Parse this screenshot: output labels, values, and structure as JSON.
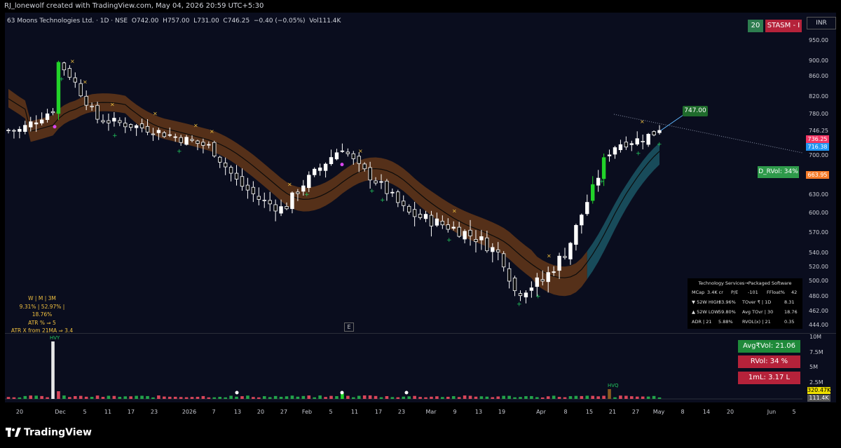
{
  "credit": "RJ_lonewolf created with TradingView.com, May 04, 2026 20:59 UTC+5:30",
  "legend": {
    "name": "63 Moons Technologies Ltd. · 1D · NSE",
    "o_label": "O",
    "o": "742.00",
    "h_label": "H",
    "h": "757.00",
    "l_label": "L",
    "l": "731.00",
    "c_label": "C",
    "c": "746.25",
    "change": "−0.40 (−0.05%)",
    "vol_label": "Vol",
    "vol": "111.4K"
  },
  "badges": {
    "days": "20",
    "stasm": "STASM - I",
    "currency": "INR"
  },
  "callout": "747.00",
  "d_rvol": "D_RVol: 34%",
  "atr_box": {
    "header": "W    |    M    |    3M",
    "values": "9.31%  |  52.97%  |  18.76%",
    "atr": "ATR % ⇒ 5",
    "atrx": "ATR X from 21MA ⇒ 3.4"
  },
  "e_button": "E",
  "stats": {
    "sector": "Technology Services→Packaged Software",
    "rows": [
      [
        "MCap",
        "3.4K cr",
        "P/E",
        "-101",
        "FFloat%",
        "42"
      ],
      [
        "▼ 52W HIGH",
        "33.96%",
        "TOver ₹ | 1D",
        "8.31",
        "",
        ""
      ],
      [
        "▲ 52W LOW",
        "59.80%",
        "Avg TOvr | 30",
        "18.76",
        "",
        ""
      ],
      [
        "ADR | 21",
        "5.88%",
        "RVOL(x) | 21",
        "0.35",
        "",
        ""
      ]
    ]
  },
  "y_axis": [
    "950.00",
    "900.00",
    "860.00",
    "820.00",
    "780.00",
    "746.25",
    "700.00",
    "630.00",
    "600.00",
    "570.00",
    "540.00",
    "520.00",
    "500.00",
    "480.00",
    "462.00",
    "444.00"
  ],
  "price_tags": {
    "last": "736.25",
    "blue": "716.38",
    "orange": "663.95"
  },
  "volume_axis": [
    "10M",
    "7.5M",
    "5M",
    "2.5M"
  ],
  "volume_tags": {
    "a": "320.47K",
    "b": "111.4K"
  },
  "volume_boxes": {
    "avg": "Avg₹Vol: 21.06 Cr",
    "rvol": "RVol: 34 %",
    "oneml": "1mL: 3.17 L"
  },
  "volume_markers": {
    "hvy": "HVY",
    "hvq": "HVQ"
  },
  "x_axis": [
    "20",
    "Dec",
    "5",
    "11",
    "17",
    "23",
    "2026",
    "7",
    "13",
    "20",
    "27",
    "Feb",
    "5",
    "11",
    "17",
    "23",
    "Mar",
    "9",
    "13",
    "19",
    "Apr",
    "8",
    "15",
    "21",
    "27",
    "May",
    "8",
    "14",
    "20",
    "Jun",
    "5"
  ],
  "brand": "TradingView",
  "chart_data": {
    "type": "candlestick",
    "title": "63 Moons Technologies Ltd. · 1D · NSE",
    "ylim": [
      444,
      960
    ],
    "last": {
      "open": 742.0,
      "high": 757.0,
      "low": 731.0,
      "close": 746.25,
      "volume": "111.4K"
    },
    "approx_close_path": [
      {
        "x": "Nov 20",
        "y": 740
      },
      {
        "x": "Dec 1",
        "y": 790
      },
      {
        "x": "Dec 2",
        "y": 905
      },
      {
        "x": "Dec 5",
        "y": 840
      },
      {
        "x": "Dec 11",
        "y": 770
      },
      {
        "x": "Dec 23",
        "y": 750
      },
      {
        "x": "Jan 7",
        "y": 715
      },
      {
        "x": "Jan 13",
        "y": 650
      },
      {
        "x": "Jan 20",
        "y": 620
      },
      {
        "x": "Jan 27",
        "y": 605
      },
      {
        "x": "Feb 2",
        "y": 645
      },
      {
        "x": "Feb 9",
        "y": 715
      },
      {
        "x": "Feb 11",
        "y": 680
      },
      {
        "x": "Feb 17",
        "y": 650
      },
      {
        "x": "Feb 23",
        "y": 600
      },
      {
        "x": "Mar 9",
        "y": 575
      },
      {
        "x": "Mar 13",
        "y": 560
      },
      {
        "x": "Mar 19",
        "y": 535
      },
      {
        "x": "Mar 25",
        "y": 485
      },
      {
        "x": "Apr 1",
        "y": 500
      },
      {
        "x": "Apr 8",
        "y": 545
      },
      {
        "x": "Apr 13",
        "y": 650
      },
      {
        "x": "Apr 17",
        "y": 700
      },
      {
        "x": "Apr 21",
        "y": 720
      },
      {
        "x": "Apr 27",
        "y": 730
      },
      {
        "x": "May 4",
        "y": 746.25
      }
    ]
  }
}
